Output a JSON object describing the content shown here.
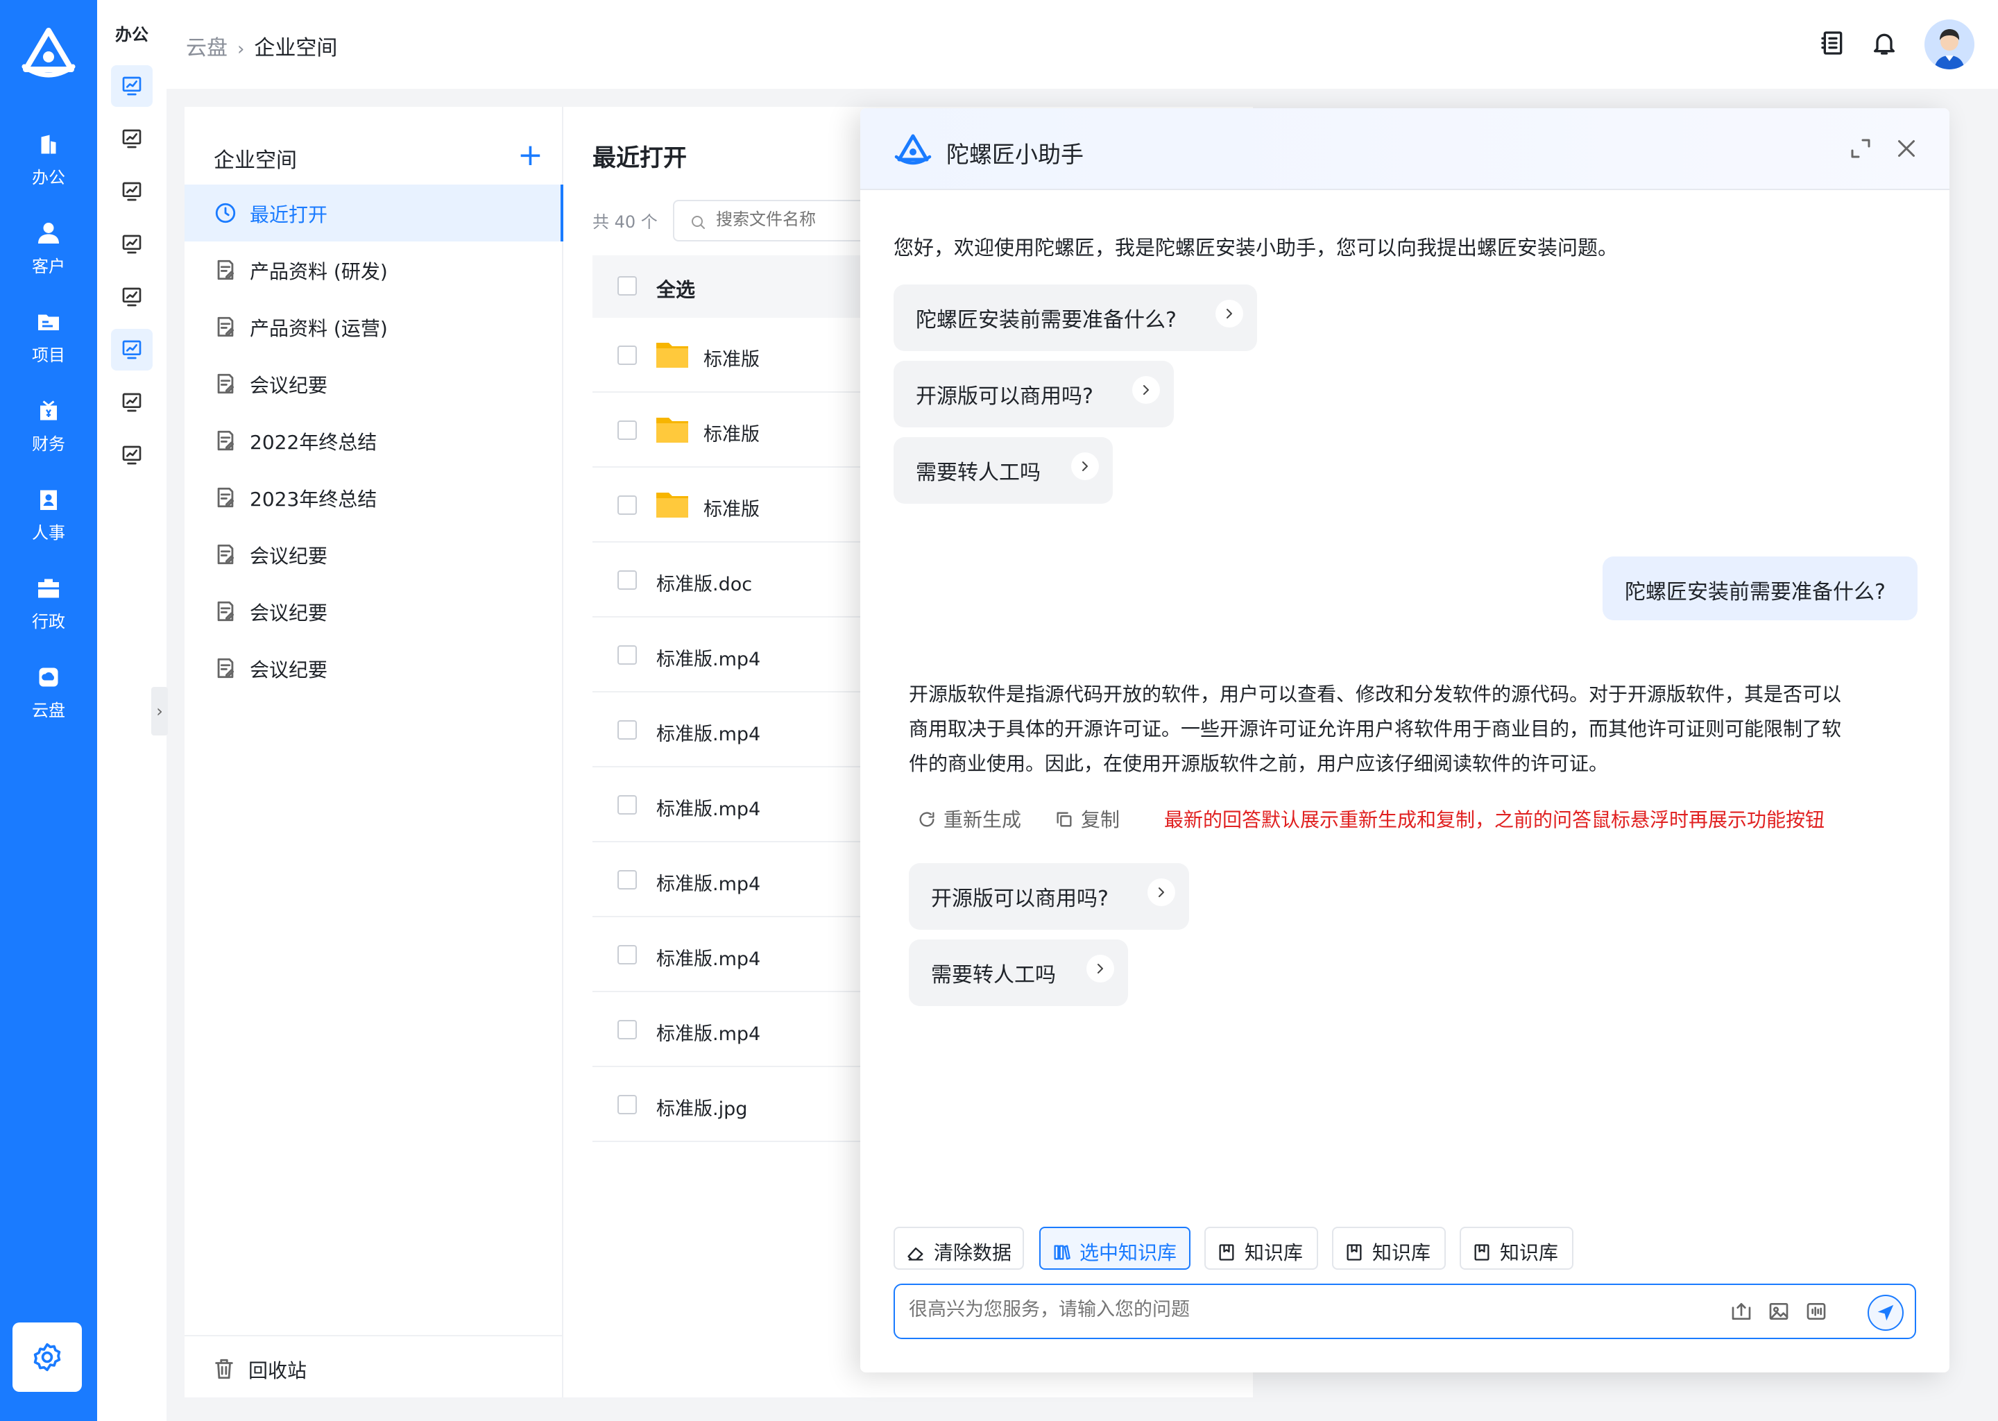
{
  "nav": {
    "items": [
      {
        "label": "办公",
        "icon": "office-building-icon"
      },
      {
        "label": "客户",
        "icon": "customer-person-icon"
      },
      {
        "label": "项目",
        "icon": "project-folder-icon"
      },
      {
        "label": "财务",
        "icon": "finance-wallet-icon"
      },
      {
        "label": "人事",
        "icon": "personnel-badge-icon"
      },
      {
        "label": "行政",
        "icon": "admin-briefcase-icon"
      },
      {
        "label": "云盘",
        "icon": "cloud-disk-icon"
      }
    ],
    "settings_icon": "gear-icon"
  },
  "subnav": {
    "title": "办公",
    "active_index": 5
  },
  "breadcrumb": {
    "root": "云盘",
    "current": "企业空间"
  },
  "folders": {
    "title": "企业空间",
    "items": [
      {
        "label": "最近打开"
      },
      {
        "label": "产品资料 (研发)"
      },
      {
        "label": "产品资料 (运营)"
      },
      {
        "label": "会议纪要"
      },
      {
        "label": "2022年终总结"
      },
      {
        "label": "2023年终总结"
      },
      {
        "label": "会议纪要"
      },
      {
        "label": "会议纪要"
      },
      {
        "label": "会议纪要"
      }
    ],
    "recycle": "回收站"
  },
  "files": {
    "title": "最近打开",
    "count": "共 40 个",
    "search_placeholder": "搜索文件名称",
    "select_all": "全选",
    "rows": [
      {
        "name": "标准版",
        "type": "folder"
      },
      {
        "name": "标准版",
        "type": "folder"
      },
      {
        "name": "标准版",
        "type": "folder"
      },
      {
        "name": "标准版.doc",
        "type": "file"
      },
      {
        "name": "标准版.mp4",
        "type": "file"
      },
      {
        "name": "标准版.mp4",
        "type": "file"
      },
      {
        "name": "标准版.mp4",
        "type": "file"
      },
      {
        "name": "标准版.mp4",
        "type": "file"
      },
      {
        "name": "标准版.mp4",
        "type": "file"
      },
      {
        "name": "标准版.mp4",
        "type": "file"
      },
      {
        "name": "标准版.jpg",
        "type": "file"
      }
    ]
  },
  "chat": {
    "title": "陀螺匠小助手",
    "greeting": "您好，欢迎使用陀螺匠，我是陀螺匠安装小助手，您可以向我提出螺匠安装问题。",
    "suggestions": [
      "陀螺匠安装前需要准备什么?",
      "开源版可以商用吗?",
      "需要转人工吗"
    ],
    "user_message": "陀螺匠安装前需要准备什么?",
    "answer_lines": [
      "开源版软件是指源代码开放的软件，用户可以查看、修改和分发软件的源代码。对于开源版软件，其是否可以",
      "商用取决于具体的开源许可证。一些开源许可证允许用户将软件用于商业目的，而其他许可证则可能限制了软",
      "件的商业使用。因此，在使用开源版软件之前，用户应该仔细阅读软件的许可证。"
    ],
    "regenerate": "重新生成",
    "copy": "复制",
    "annotation": "最新的回答默认展示重新生成和复制，之前的问答鼠标悬浮时再展示功能按钮",
    "followups": [
      "开源版可以商用吗?",
      "需要转人工吗"
    ],
    "quick_buttons": [
      {
        "label": "清除数据",
        "icon": "eraser-icon"
      },
      {
        "label": "选中知识库",
        "icon": "books-icon",
        "selected": true
      },
      {
        "label": "知识库",
        "icon": "bookmark-icon"
      },
      {
        "label": "知识库",
        "icon": "bookmark-icon"
      },
      {
        "label": "知识库",
        "icon": "bookmark-icon"
      }
    ],
    "input_placeholder": "很高兴为您服务，请输入您的问题"
  },
  "colors": {
    "accent": "#1a7bff",
    "note": "#e02020"
  }
}
